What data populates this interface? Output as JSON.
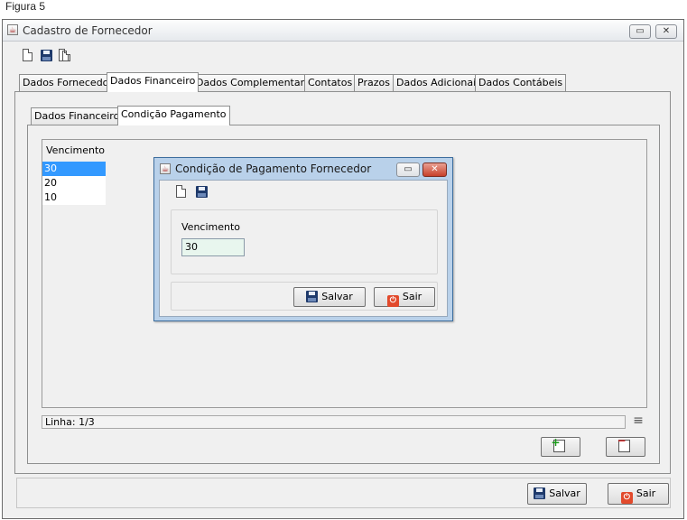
{
  "caption": "Figura 5",
  "window": {
    "title": "Cadastro de Fornecedor",
    "restore_glyph": "▭",
    "close_glyph": "✕"
  },
  "main_tabs": [
    "Dados Fornecedor",
    "Dados Financeiro",
    "Dados Complementares",
    "Contatos",
    "Prazos",
    "Dados Adicionais",
    "Dados Contábeis"
  ],
  "sub_tabs": [
    "Dados Financeiros",
    "Condição Pagamento"
  ],
  "list": {
    "header": "Vencimento",
    "rows": [
      "30",
      "20",
      "10"
    ],
    "selected_index": 0
  },
  "status_line": "Linha: 1/3",
  "footer": {
    "save_label": "Salvar",
    "exit_label": "Sair"
  },
  "dialog": {
    "title": "Condição de Pagamento Fornecedor",
    "field_label": "Vencimento",
    "field_value": "30",
    "save_label": "Salvar",
    "exit_label": "Sair"
  },
  "icons": {
    "exit_glyph": "⏻",
    "menu_glyph": "≡"
  },
  "colors": {
    "selection": "#3399ff",
    "dialog_frame": "#b9d1ea",
    "field_bg": "#e8f6ee"
  }
}
